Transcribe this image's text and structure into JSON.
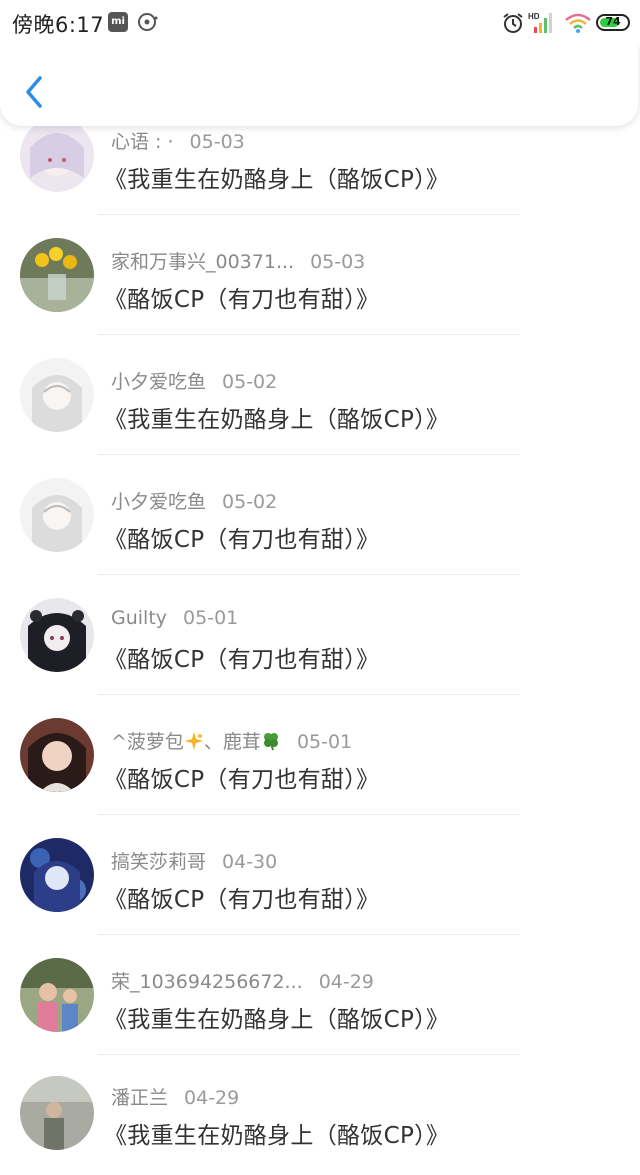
{
  "status_bar": {
    "time": "傍晚6:17",
    "mi_label": "mi",
    "network": "HD",
    "battery": "74",
    "battery_level": 0.74
  },
  "header": {
    "back_icon": "chevron-left-icon",
    "accent": "#2b8ee8"
  },
  "comments": [
    {
      "user": "心语 : ·",
      "date": "05-03",
      "title": "《我重生在奶酪身上（酪饭CP）》",
      "avatar_color": "#d8cde6"
    },
    {
      "user": "家和万事兴_00371...",
      "date": "05-03",
      "title": "《酪饭CP（有刀也有甜）》",
      "avatar_color": "#9aa37a"
    },
    {
      "user": "小夕爱吃鱼",
      "date": "05-02",
      "title": "《我重生在奶酪身上（酪饭CP）》",
      "avatar_color": "#e9e9e9"
    },
    {
      "user": "小夕爱吃鱼",
      "date": "05-02",
      "title": "《酪饭CP（有刀也有甜）》",
      "avatar_color": "#e9e9e9"
    },
    {
      "user": "Guilty",
      "date": "05-01",
      "title": "《酪饭CP（有刀也有甜）》",
      "avatar_color": "#2a2a33"
    },
    {
      "user_a": "^菠萝包",
      "user_b": "、鹿茸",
      "date": "05-01",
      "title": "《酪饭CP（有刀也有甜）》",
      "avatar_color": "#b46a5c"
    },
    {
      "user": "搞笑莎莉哥",
      "date": "04-30",
      "title": "《酪饭CP（有刀也有甜）》",
      "avatar_color": "#2c4a9a"
    },
    {
      "user": "荣_103694256672...",
      "date": "04-29",
      "title": "《我重生在奶酪身上（酪饭CP）》",
      "avatar_color": "#7c8f6a"
    },
    {
      "user": "潘正兰",
      "date": "04-29",
      "title": "《我重生在奶酪身上（酪饭CP）》",
      "avatar_color": "#8d8f88"
    }
  ]
}
